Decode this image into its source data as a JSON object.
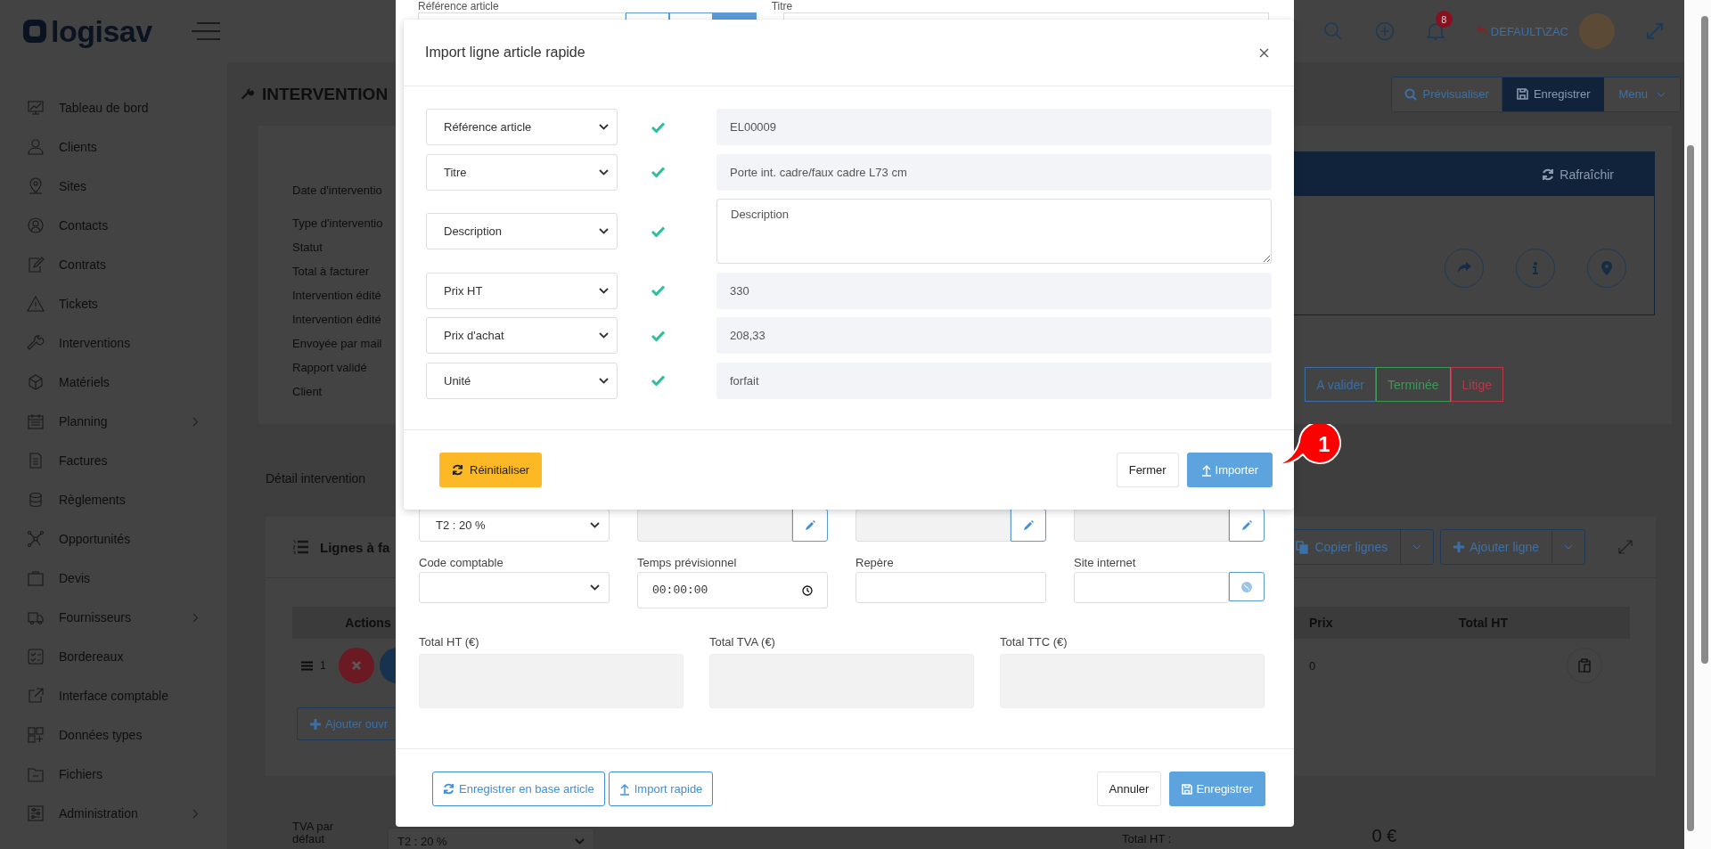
{
  "top_bar": {
    "logo": "logisav",
    "notification_count": "8",
    "user": "DEFAULT\\ZAC"
  },
  "sidebar": {
    "items": [
      {
        "label": "Tableau de bord",
        "expandable": false
      },
      {
        "label": "Clients",
        "expandable": false
      },
      {
        "label": "Sites",
        "expandable": false
      },
      {
        "label": "Contacts",
        "expandable": false
      },
      {
        "label": "Contrats",
        "expandable": false
      },
      {
        "label": "Tickets",
        "expandable": false
      },
      {
        "label": "Interventions",
        "expandable": false
      },
      {
        "label": "Matériels",
        "expandable": false
      },
      {
        "label": "Planning",
        "expandable": true
      },
      {
        "label": "Factures",
        "expandable": false
      },
      {
        "label": "Règlements",
        "expandable": false
      },
      {
        "label": "Opportunités",
        "expandable": false
      },
      {
        "label": "Devis",
        "expandable": false
      },
      {
        "label": "Fournisseurs",
        "expandable": true
      },
      {
        "label": "Bordereaux",
        "expandable": false
      },
      {
        "label": "Interface comptable",
        "expandable": false
      },
      {
        "label": "Données types",
        "expandable": false
      },
      {
        "label": "Fichiers",
        "expandable": false
      },
      {
        "label": "Administration",
        "expandable": true
      }
    ]
  },
  "page": {
    "title": "INTERVENTION",
    "header_buttons": [
      {
        "label": "Prévisualiser",
        "kind": "outline"
      },
      {
        "label": "Enregistrer",
        "kind": "primary"
      },
      {
        "label": "Menu",
        "kind": "dropdown"
      }
    ],
    "info_labels": [
      "Date d'interventio",
      "Type d'interventio",
      "Statut",
      "Total à facturer",
      "Intervention édité",
      "Intervention édité",
      "Envoyée par mail",
      "Rapport validé",
      "Client"
    ],
    "panel": {
      "refresh": "Rafraîchir"
    },
    "status_buttons": [
      {
        "label": "A valider",
        "color": "#3a6ea6"
      },
      {
        "label": "Terminée",
        "color": "#3a9a58"
      },
      {
        "label": "Litige",
        "color": "#b83848"
      }
    ],
    "tab": "Détail intervention",
    "lines_card": {
      "title": "Lignes à fa",
      "copy_button": "Copier lignes",
      "add_button": "Ajouter ligne",
      "columns": [
        "Actions",
        "Prix",
        "Total HT"
      ],
      "rows": [
        {
          "number": "1",
          "price": "0"
        }
      ],
      "add_work_button": "Ajouter ouvr"
    },
    "footer": {
      "vat_label": "TVA par défaut",
      "vat_value": "T2 : 20 %",
      "total_label": "Total HT :",
      "total_value": "0 €"
    }
  },
  "article_modal": {
    "top_labels": [
      "Référence article",
      "Titre"
    ],
    "vat_select": "T2 : 20 %",
    "locked_fields": [
      {
        "disabled": true
      },
      {
        "disabled": true
      },
      {
        "disabled": true
      }
    ],
    "fields": [
      {
        "label": "Code comptable",
        "kind": "select"
      },
      {
        "label": "Temps prévisionnel",
        "kind": "time",
        "value": "00:00:00"
      },
      {
        "label": "Repère",
        "kind": "text"
      },
      {
        "label": "Site internet",
        "kind": "url"
      }
    ],
    "totals": [
      "Total HT (€)",
      "Total TVA (€)",
      "Total TTC (€)"
    ],
    "buttons": {
      "save_to_catalog": "Enregistrer en base article",
      "quick_import": "Import rapide",
      "cancel": "Annuler",
      "save": "Enregistrer"
    }
  },
  "import_modal": {
    "title": "Import ligne article rapide",
    "rows": [
      {
        "field": "Référence article",
        "valid": true,
        "kind": "input",
        "value": "EL00009"
      },
      {
        "field": "Titre",
        "valid": true,
        "kind": "input",
        "value": "Porte int. cadre/faux cadre L73 cm"
      },
      {
        "field": "Description",
        "valid": true,
        "kind": "textarea",
        "placeholder": "Description"
      },
      {
        "field": "Prix HT",
        "valid": true,
        "kind": "input",
        "value": "330"
      },
      {
        "field": "Prix d'achat",
        "valid": true,
        "kind": "input",
        "value": "208,33"
      },
      {
        "field": "Unité",
        "valid": true,
        "kind": "input",
        "value": "forfait"
      }
    ],
    "buttons": {
      "reset": "Réinitialiser",
      "close": "Fermer",
      "import": "Importer"
    }
  },
  "callout": {
    "number": "1"
  }
}
